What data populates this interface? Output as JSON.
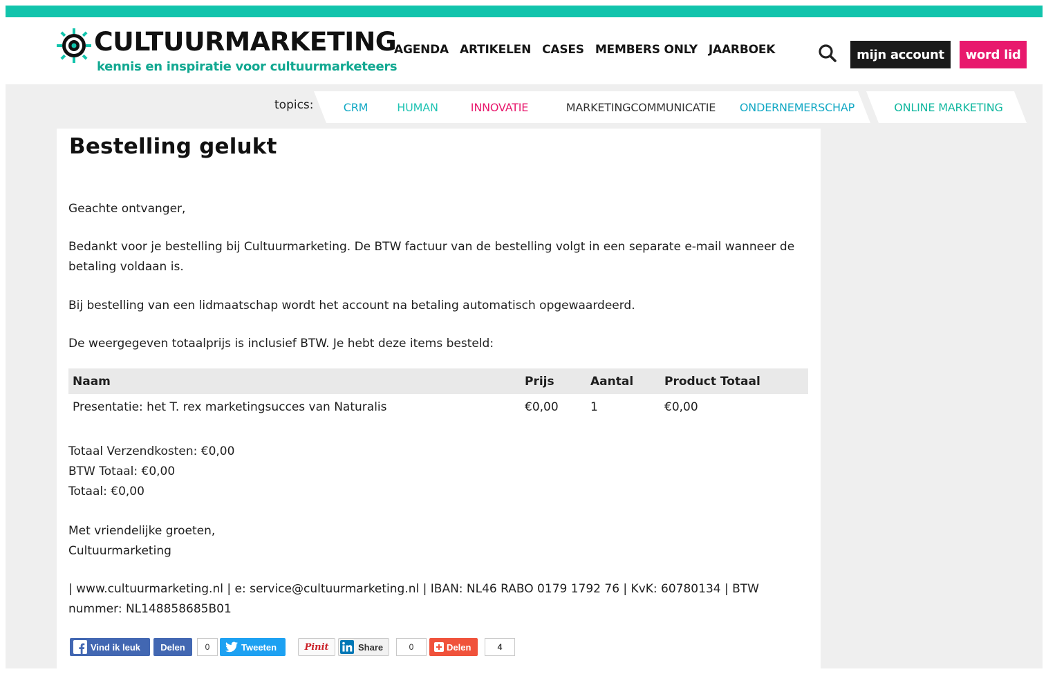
{
  "brand": {
    "name": "CULTUURMARKETING",
    "tagline": "kennis en inspiratie voor cultuurmarketeers",
    "accent": "#12c4ac",
    "pink": "#e8196d"
  },
  "nav": {
    "items": [
      "AGENDA",
      "ARTIKELEN",
      "CASES",
      "MEMBERS ONLY",
      "JAARBOEK"
    ],
    "search_icon": "search-icon",
    "account_label": "mijn account",
    "join_label": "word lid"
  },
  "topics": {
    "label": "topics:",
    "items": [
      {
        "label": "CRM",
        "color": "#12a8c4"
      },
      {
        "label": "HUMAN",
        "color": "#22c4b4"
      },
      {
        "label": "INNOVATIE",
        "color": "#e8196d"
      },
      {
        "label": "MARKETINGCOMMUNICATIE",
        "color": "#333333"
      },
      {
        "label": "ONDERNEMERSCHAP",
        "color": "#12a8c4"
      },
      {
        "label": "ONLINE MARKETING",
        "color": "#12b8a0"
      }
    ]
  },
  "order": {
    "title": "Bestelling gelukt",
    "greeting": "Geachte ontvanger,",
    "thanks_line1": "Bedankt voor je bestelling bij Cultuurmarketing. De BTW factuur van de bestelling volgt in een separate e-mail wanneer de",
    "thanks_line2": "betaling voldaan is.",
    "membership": "Bij bestelling van een lidmaatschap wordt het account na betaling automatisch opgewaardeerd.",
    "intro": "De weergegeven totaalprijs is inclusief BTW. Je hebt deze items besteld:",
    "table": {
      "headers": [
        "Naam",
        "Prijs",
        "Aantal",
        "Product Totaal"
      ],
      "rows": [
        [
          "Presentatie: het T. rex marketingsucces van Naturalis",
          "€0,00",
          "1",
          "€0,00"
        ]
      ]
    },
    "shipping": "Totaal Verzendkosten: €0,00",
    "vat_total": "BTW Totaal: €0,00",
    "total": "Totaal: €0,00",
    "closing": "Met vriendelijke groeten,",
    "signature": "Cultuurmarketing",
    "footer_line1": "| www.cultuurmarketing.nl | e: service@cultuurmarketing.nl | IBAN: NL46 RABO 0179 1792 76 | KvK: 60780134 | BTW",
    "footer_line2": "nummer: NL148858685B01"
  },
  "social": {
    "fb_like": "Vind ik leuk",
    "fb_share": "Delen",
    "fb_count": "0",
    "tweet": "Tweeten",
    "pin": "Pinit",
    "li_share": "Share",
    "li_count": "0",
    "addthis_share": "Delen",
    "addthis_count": "4"
  }
}
